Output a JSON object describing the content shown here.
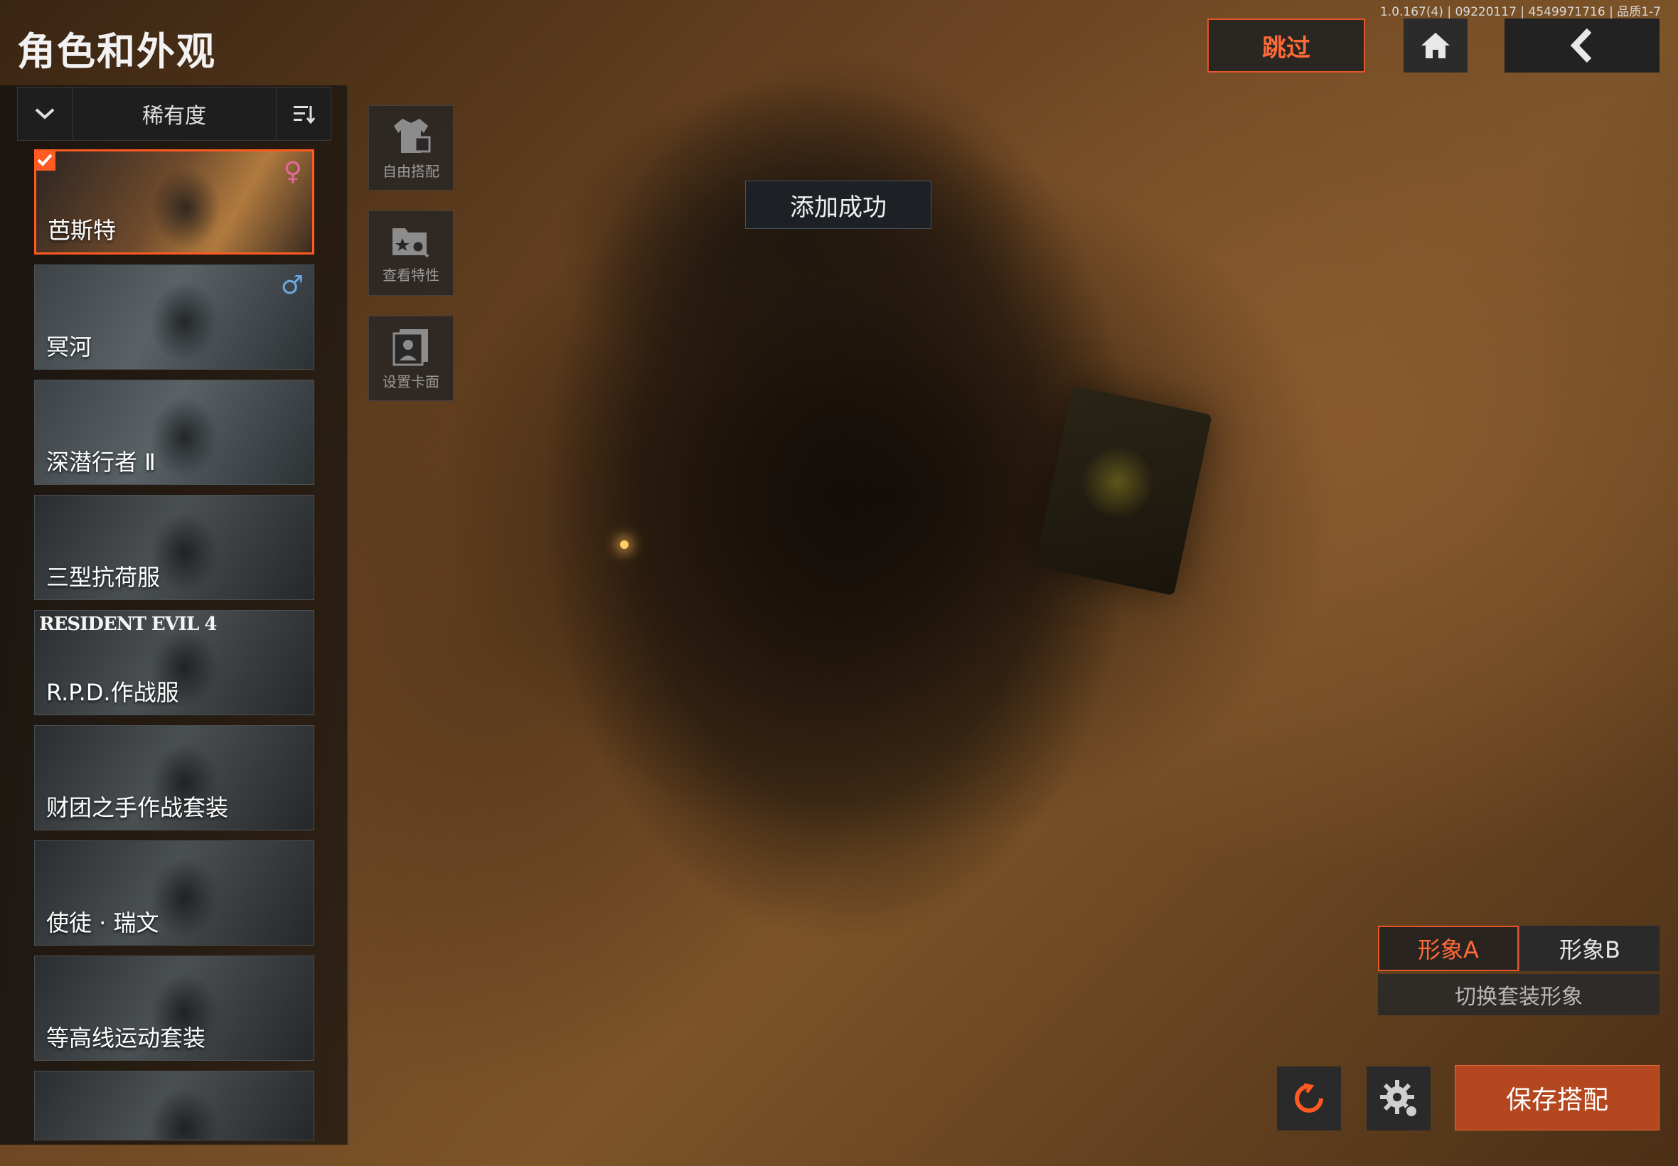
{
  "version_info": "1.0.167(4) | 09220117 | 4549971716 | 品质1-7",
  "page_title": "角色和外观",
  "header": {
    "skip_label": "跳过",
    "home_icon": "home-icon",
    "back_icon": "chevron-left-icon"
  },
  "sort_bar": {
    "label": "稀有度",
    "dropdown_icon": "chevron-down-icon",
    "sort_icon": "sort-icon"
  },
  "characters": [
    {
      "name": "芭斯特",
      "gender": "♀",
      "gender_color": "#e06a9a",
      "selected": true
    },
    {
      "name": "冥河",
      "gender": "♂",
      "gender_color": "#6aa6e0",
      "selected": false
    },
    {
      "name": "深潜行者 Ⅱ",
      "gender": "",
      "selected": false
    },
    {
      "name": "三型抗荷服",
      "gender": "",
      "selected": false
    },
    {
      "name": "R.P.D.作战服",
      "gender": "",
      "banner": "RESIDENT EVIL 4",
      "selected": false
    },
    {
      "name": "财团之手作战套装",
      "gender": "",
      "selected": false
    },
    {
      "name": "使徒 · 瑞文",
      "gender": "",
      "selected": false
    },
    {
      "name": "等高线运动套装",
      "gender": "",
      "selected": false
    },
    {
      "name": "",
      "gender": "",
      "selected": false
    }
  ],
  "tools": [
    {
      "label": "自由搭配",
      "icon": "outfit-icon"
    },
    {
      "label": "查看特性",
      "icon": "view-traits-icon"
    },
    {
      "label": "设置卡面",
      "icon": "card-portrait-icon"
    }
  ],
  "toast": "添加成功",
  "look": {
    "a_label": "形象A",
    "b_label": "形象B",
    "caption": "切换套装形象"
  },
  "bottom": {
    "reset_icon": "reset-icon",
    "gear_icon": "gear-icon",
    "save_label": "保存搭配"
  },
  "colors": {
    "accent": "#ff5a22",
    "save_button": "#b4471f"
  }
}
